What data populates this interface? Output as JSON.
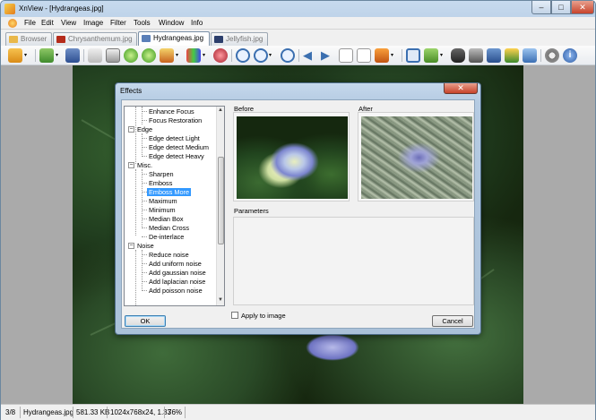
{
  "window": {
    "title": "XnView - [Hydrangeas.jpg]",
    "min": "–",
    "max": "□",
    "close": "✕"
  },
  "menu": [
    "File",
    "Edit",
    "View",
    "Image",
    "Filter",
    "Tools",
    "Window",
    "Info"
  ],
  "tabs": [
    {
      "label": "Browser"
    },
    {
      "label": "Chrysanthemum.jpg"
    },
    {
      "label": "Hydrangeas.jpg"
    },
    {
      "label": "Jellyfish.jpg"
    }
  ],
  "status": {
    "index": "3/8",
    "file": "Hydrangeas.jpg",
    "size": "581.33 KB",
    "dims": "1024x768x24, 1.33",
    "zoom": "76%"
  },
  "dialog": {
    "title": "Effects",
    "close": "✕",
    "before_label": "Before",
    "after_label": "After",
    "parameters_label": "Parameters",
    "apply_label": "Apply to image",
    "ok_label": "OK",
    "cancel_label": "Cancel",
    "tree": {
      "top_children": [
        "Enhance Focus",
        "Focus Restoration"
      ],
      "edge": {
        "label": "Edge",
        "children": [
          "Edge detect Light",
          "Edge detect Medium",
          "Edge detect Heavy"
        ]
      },
      "misc": {
        "label": "Misc.",
        "children": [
          "Sharpen",
          "Emboss",
          "Emboss More",
          "Maximum",
          "Minimum",
          "Median Box",
          "Median Cross",
          "De-interlace"
        ]
      },
      "noise": {
        "label": "Noise",
        "children": [
          "Reduce noise",
          "Add uniform noise",
          "Add gaussian noise",
          "Add laplacian noise",
          "Add poisson noise"
        ]
      },
      "selected": "Emboss More"
    }
  },
  "colors": {
    "selection": "#3399ff",
    "titlebar": "#b9cfe6"
  }
}
